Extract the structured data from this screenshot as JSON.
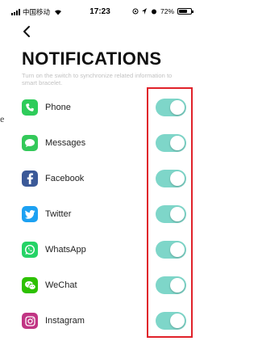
{
  "status_bar": {
    "carrier": "中国移动",
    "time": "17:23",
    "battery": "72%",
    "battery_level": 0.72
  },
  "page": {
    "title": "NOTIFICATIONS",
    "subtitle": "Turn on the switch to synchronize related information to smart bracelet."
  },
  "colors": {
    "toggle_on": "#7ed6c9",
    "highlight": "#e0222a",
    "phone": "#2ecc5a",
    "messages": "#34c95a",
    "facebook": "#3b5998",
    "twitter": "#1da1f2",
    "whatsapp": "#25d366",
    "wechat": "#2dc100",
    "instagram": "#c13584"
  },
  "apps": [
    {
      "label": "Phone",
      "icon": "phone-icon",
      "enabled": true
    },
    {
      "label": "Messages",
      "icon": "message-bubble-icon",
      "enabled": true
    },
    {
      "label": "Facebook",
      "icon": "facebook-icon",
      "enabled": true
    },
    {
      "label": "Twitter",
      "icon": "twitter-bird-icon",
      "enabled": true
    },
    {
      "label": "WhatsApp",
      "icon": "whatsapp-icon",
      "enabled": true
    },
    {
      "label": "WeChat",
      "icon": "wechat-icon",
      "enabled": true
    },
    {
      "label": "Instagram",
      "icon": "instagram-icon",
      "enabled": true
    }
  ],
  "edge_fragment": "e"
}
